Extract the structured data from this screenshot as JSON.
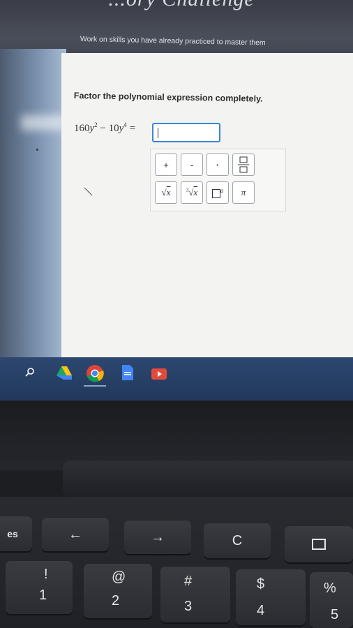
{
  "header": {
    "title": "...ory Challenge",
    "subtitle": "Work on skills you have already practiced to master them"
  },
  "question": {
    "prompt": "Factor the polynomial expression completely.",
    "expression": {
      "c1": "160",
      "v1": "y",
      "e1": "2",
      "minus": "−",
      "c2": "10",
      "v2": "y",
      "e2": "4",
      "equals": "="
    }
  },
  "keypad": {
    "plus": "+",
    "minus": "-",
    "dot": "·",
    "pi": "π",
    "superscript_var": "a",
    "sqrt_var": "x",
    "cbrt_var": "x",
    "cbrt_index": "3"
  },
  "shelf": {
    "icons": [
      "search-icon",
      "drive-icon",
      "chrome-icon",
      "docs-icon",
      "slides-icon"
    ]
  },
  "keyboard": {
    "row1": [
      "←",
      "→",
      "C"
    ],
    "row2": [
      {
        "top": "!",
        "bottom": "1"
      },
      {
        "top": "@",
        "bottom": "2"
      },
      {
        "top": "#",
        "bottom": "3"
      },
      {
        "top": "$",
        "bottom": "4"
      },
      {
        "top": "%",
        "bottom": "5"
      }
    ],
    "esc_label": "es"
  },
  "colors": {
    "input_border": "#3a86d4",
    "shelf": "#22395c",
    "panel": "#f3f3f1"
  }
}
